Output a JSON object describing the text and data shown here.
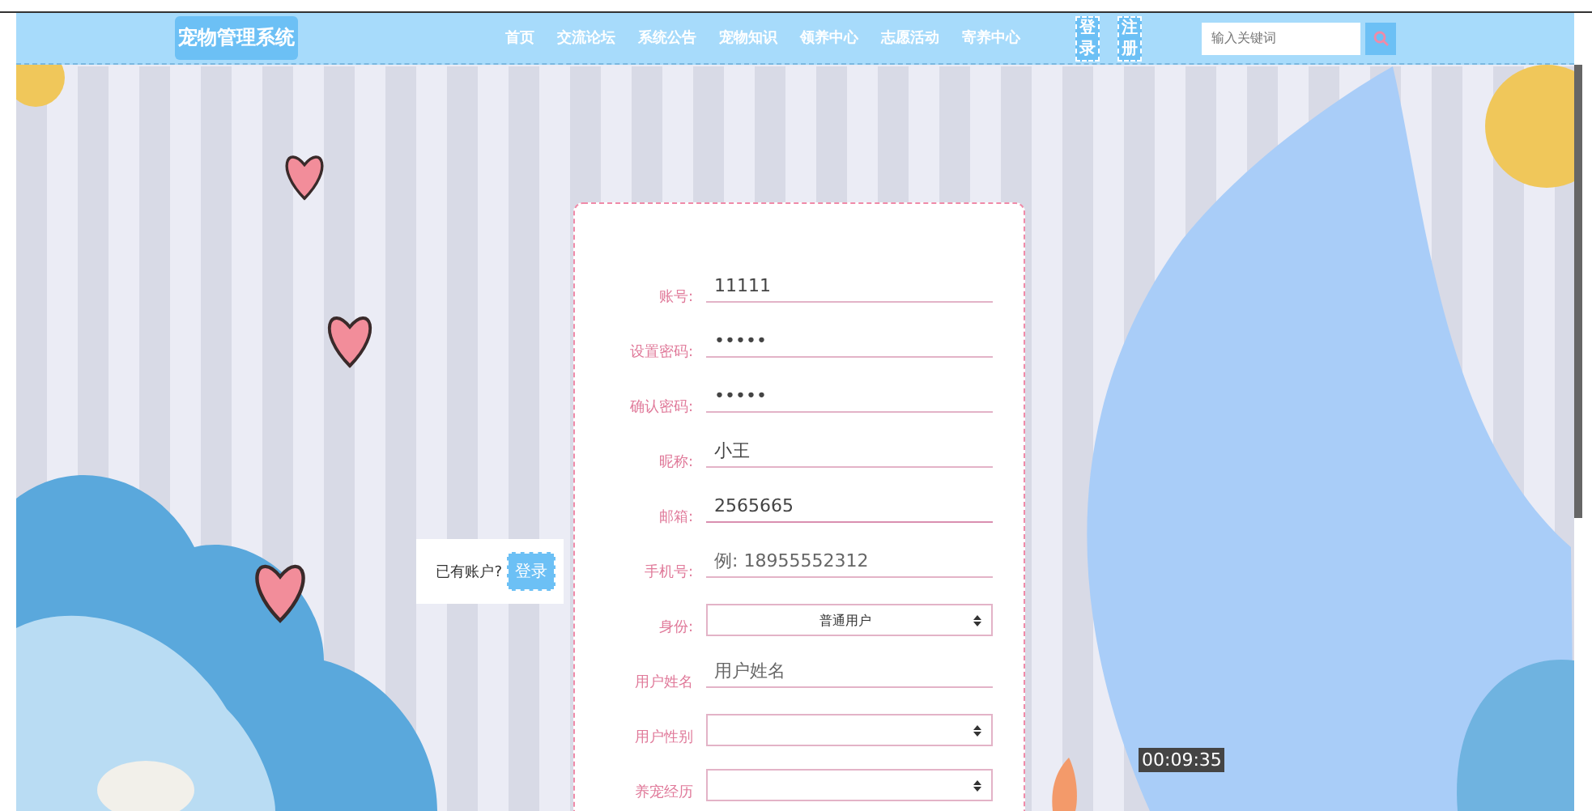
{
  "header": {
    "logo": "宠物管理系统",
    "nav": [
      {
        "label": "首页"
      },
      {
        "label": "交流论坛"
      },
      {
        "label": "系统公告"
      },
      {
        "label": "宠物知识"
      },
      {
        "label": "领养中心"
      },
      {
        "label": "志愿活动"
      },
      {
        "label": "寄养中心"
      }
    ],
    "auth_buttons": [
      {
        "label": "登录"
      },
      {
        "label": "注册"
      }
    ],
    "search": {
      "placeholder": "输入关键词"
    }
  },
  "login_hint": {
    "text": "已有账户?",
    "button": "登录"
  },
  "form": {
    "fields": [
      {
        "kind": "text",
        "label": "账号:",
        "value": "11111"
      },
      {
        "kind": "text",
        "label": "设置密码:",
        "value": "•••••"
      },
      {
        "kind": "text",
        "label": "确认密码:",
        "value": "•••••"
      },
      {
        "kind": "text",
        "label": "昵称:",
        "value": "小王"
      },
      {
        "kind": "text",
        "label": "邮箱:",
        "value": "2565665",
        "focused": true
      },
      {
        "kind": "text",
        "label": "手机号:",
        "placeholder": "例: 18955552312"
      },
      {
        "kind": "select",
        "label": "身份:",
        "value": "普通用户"
      },
      {
        "kind": "text",
        "label": "用户姓名",
        "placeholder": "用户姓名"
      },
      {
        "kind": "select",
        "label": "用户性别"
      },
      {
        "kind": "select",
        "label": "养宠经历"
      }
    ]
  },
  "recording_timer": "00:09:35"
}
